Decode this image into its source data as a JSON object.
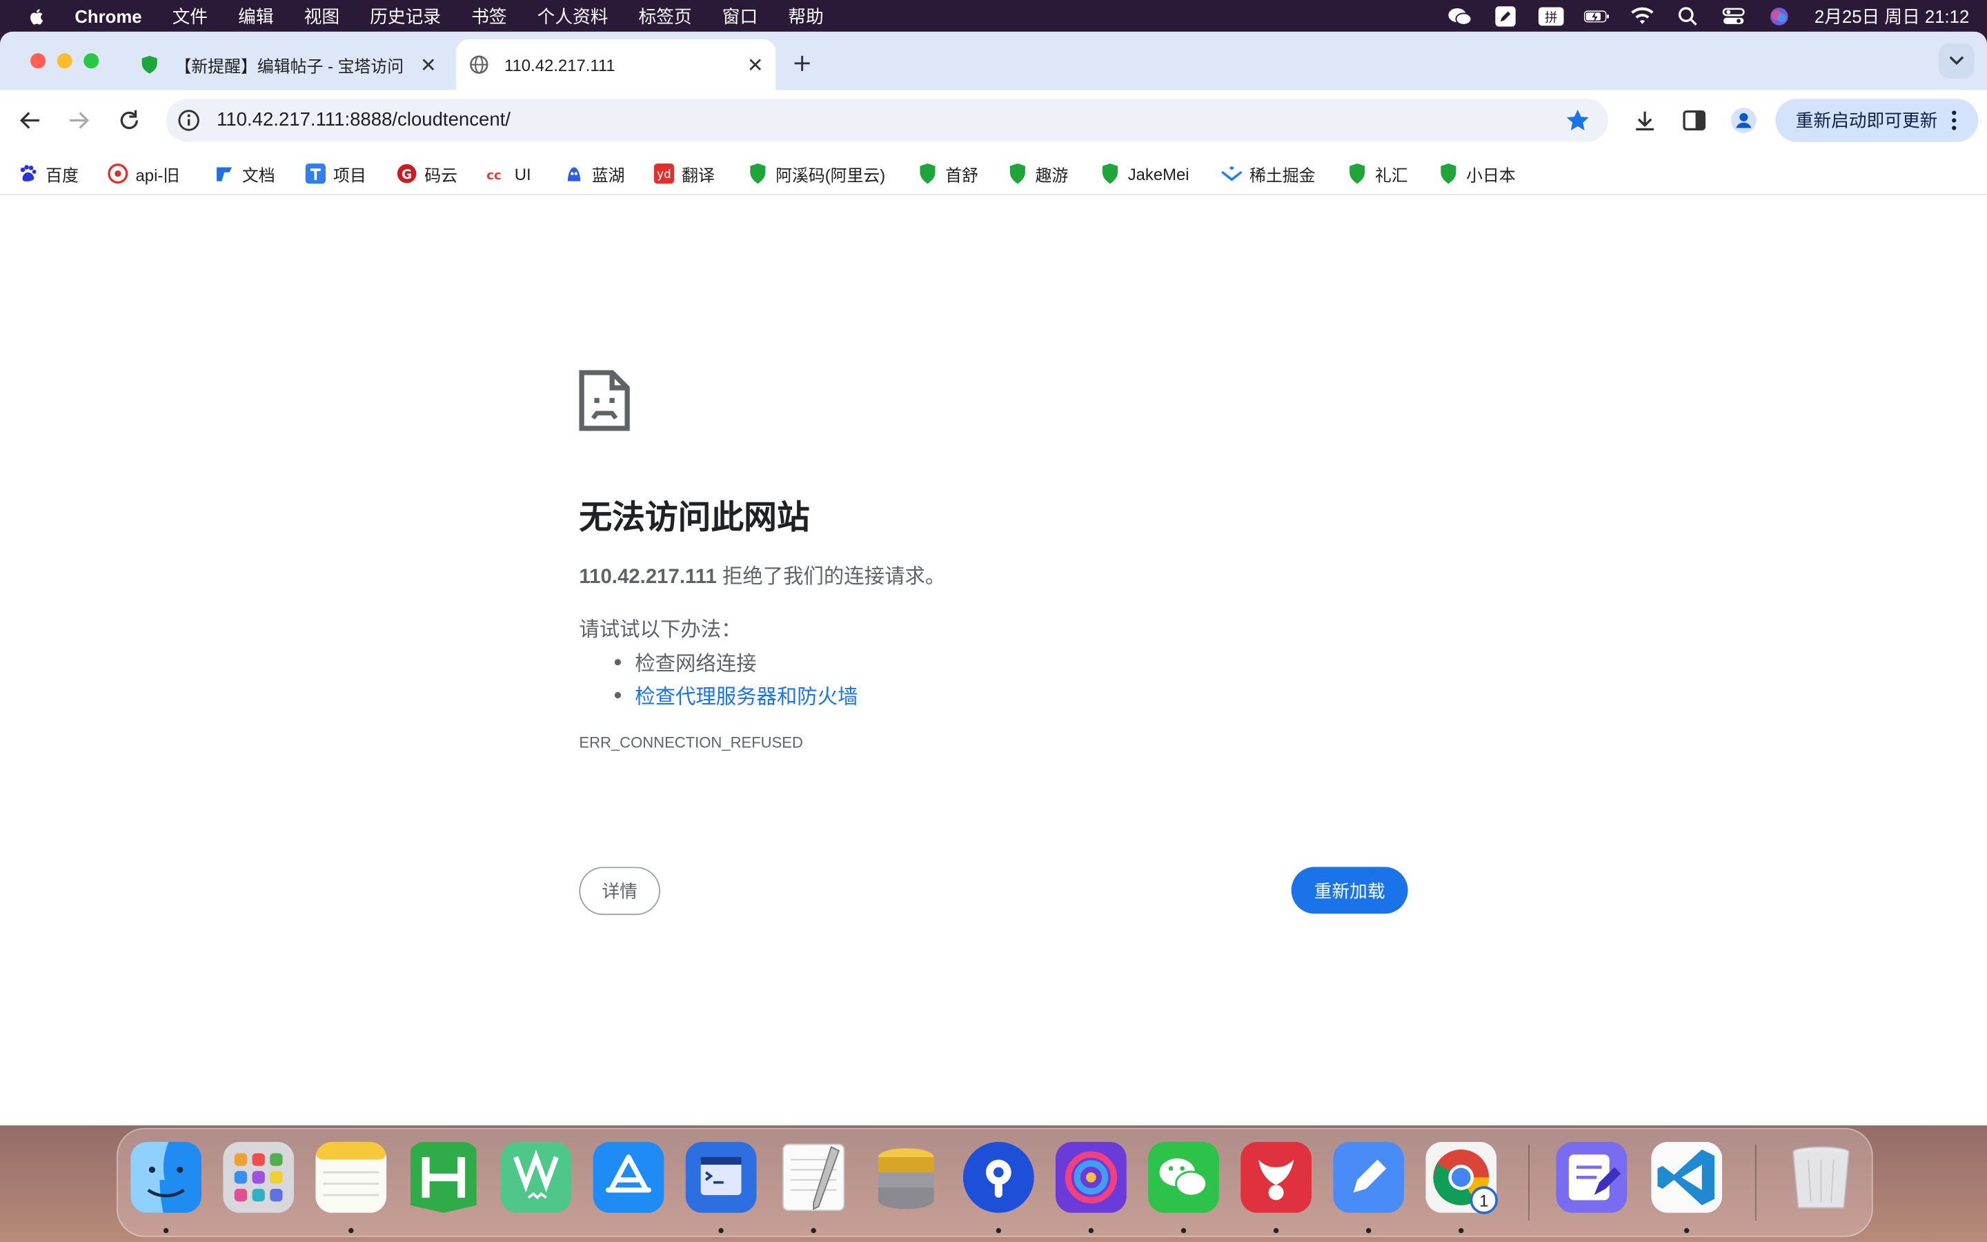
{
  "menubar": {
    "app_name": "Chrome",
    "items": [
      "文件",
      "编辑",
      "视图",
      "历史记录",
      "书签",
      "个人资料",
      "标签页",
      "窗口",
      "帮助"
    ],
    "clock": "2月25日 周日  21:12"
  },
  "tabs": [
    {
      "title": "【新提醒】编辑帖子 - 宝塔访问",
      "active": false
    },
    {
      "title": "110.42.217.111",
      "active": true
    }
  ],
  "toolbar": {
    "url": "110.42.217.111:8888/cloudtencent/",
    "update_label": "重新启动即可更新"
  },
  "bookmarks": [
    "百度",
    "api-旧",
    "文档",
    "项目",
    "码云",
    "UI",
    "蓝湖",
    "翻译",
    "阿溪码(阿里云)",
    "首舒",
    "趣游",
    "JakeMei",
    "稀土掘金",
    "礼汇",
    "小日本"
  ],
  "error": {
    "title": "无法访问此网站",
    "host": "110.42.217.111",
    "desc_rest": " 拒绝了我们的连接请求。",
    "try_label": "请试试以下办法：",
    "suggestions": [
      "检查网络连接",
      "检查代理服务器和防火墙"
    ],
    "code": "ERR_CONNECTION_REFUSED",
    "details_label": "详情",
    "reload_label": "重新加载"
  },
  "dock": {
    "chrome_badge": "1"
  },
  "colors": {
    "accent": "#1a73e8",
    "tabstrip": "#dde7f7",
    "bookmark_star": "#1a73e8"
  }
}
